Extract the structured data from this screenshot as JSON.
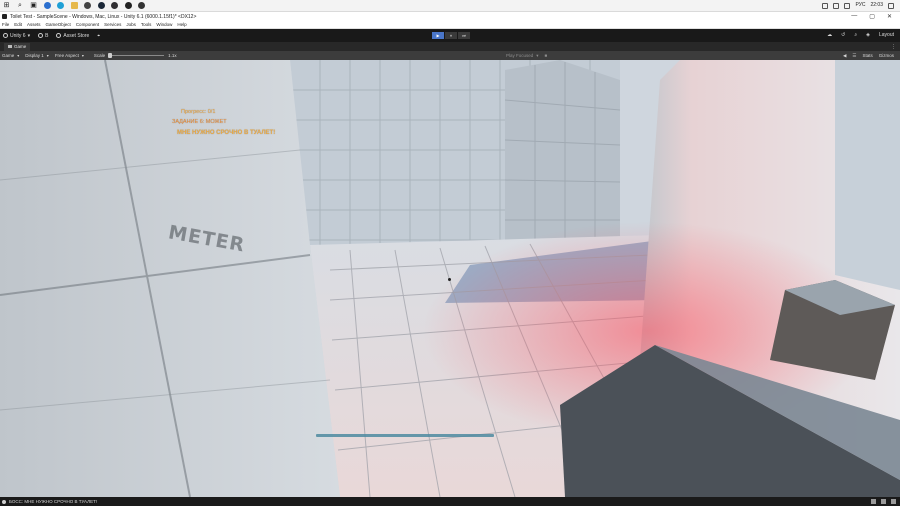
{
  "taskbar": {
    "icons": [
      "windows-start-icon",
      "search-icon",
      "task-view-icon",
      "file-explorer-icon",
      "edge-browser-icon",
      "folder-icon",
      "unity-hub-icon",
      "steam-icon",
      "obs-icon",
      "unity-icon",
      "chrome-icon"
    ],
    "tray": {
      "language": "РУС",
      "time": "22:03"
    }
  },
  "window": {
    "title": "Toilet Test - SampleScene - Windows, Mac, Linux - Unity 6.1 (6000.1.15f1)* <DX12>",
    "controls": [
      "—",
      "▢",
      "✕"
    ]
  },
  "menubar": {
    "items": [
      "File",
      "Edit",
      "Assets",
      "GameObject",
      "Component",
      "Services",
      "Jobs",
      "Tools",
      "Window",
      "Help"
    ]
  },
  "toolbar": {
    "account": "Unity 6",
    "account_caret": "▾",
    "version_control": "B",
    "asset_store": "Asset Store",
    "play": "▶",
    "pause": "⏸",
    "step": "⏭",
    "layout": "Layout"
  },
  "tabs": {
    "game_tab": "Game",
    "more": "⋮"
  },
  "game_toolbar": {
    "mode": "Game",
    "display": "Display 1",
    "aspect": "Free Aspect",
    "scale_label": "Scale",
    "scale_value": "1.1x",
    "scale_fraction": 0.0,
    "play_mode": "Play Focused",
    "stats": "Stats",
    "gizmos": "Gizmos"
  },
  "hud": {
    "progress": "Прогресс: 0/1",
    "task": "ЗАДАНИЕ 6: МОЖЕТ",
    "message": "МНЕ НУЖНО СРОЧНО В ТУАЛЕТ!",
    "ruler_text": "METER",
    "health_fraction": 1.0
  },
  "statusbar": {
    "message": "БОСС: МНЕ НУЖНО СРОЧНО В ТУАЛЕТ!"
  },
  "colors": {
    "hud_text": "#f0a63a",
    "toolbar_bg": "#191919",
    "play_active": "#4a76c9",
    "hp_bar": "#4d8aa0"
  }
}
